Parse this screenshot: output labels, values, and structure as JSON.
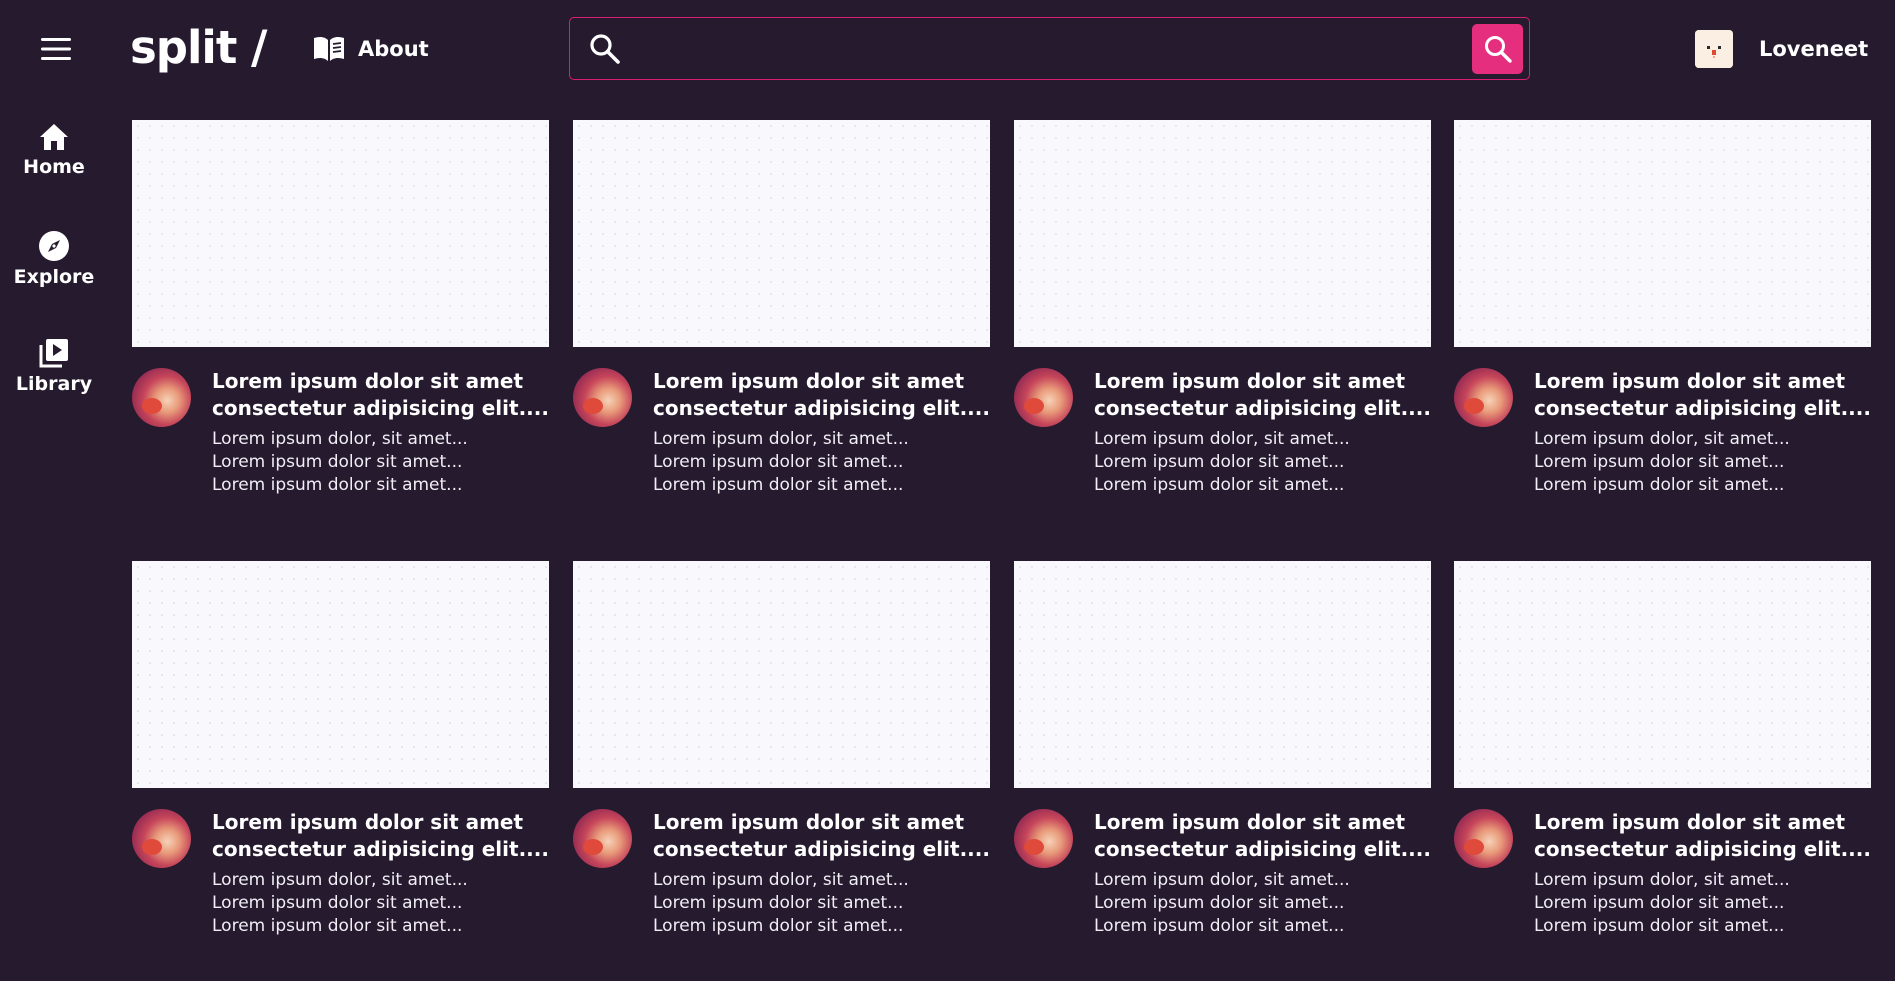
{
  "header": {
    "menu_icon": "hamburger-menu-icon",
    "logo_text": "split /",
    "about_icon": "open-book-icon",
    "about_label": "About",
    "search": {
      "value": "",
      "placeholder": "",
      "lead_icon": "search-icon",
      "submit_icon": "search-icon"
    },
    "user": {
      "avatar_icon": "user-avatar",
      "name": "Loveneet"
    }
  },
  "sidebar": {
    "items": [
      {
        "icon": "home-icon",
        "label": "Home"
      },
      {
        "icon": "compass-icon",
        "label": "Explore"
      },
      {
        "icon": "video-library-icon",
        "label": "Library"
      }
    ]
  },
  "videos": [
    {
      "title_1": "Lorem ipsum dolor sit amet",
      "title_2": "consectetur adipisicing elit....",
      "meta_1": "Lorem ipsum dolor, sit amet...",
      "meta_2": "Lorem ipsum dolor sit amet...",
      "meta_3": "Lorem ipsum dolor sit amet..."
    },
    {
      "title_1": "Lorem ipsum dolor sit amet",
      "title_2": "consectetur adipisicing elit....",
      "meta_1": "Lorem ipsum dolor, sit amet...",
      "meta_2": "Lorem ipsum dolor sit amet...",
      "meta_3": "Lorem ipsum dolor sit amet..."
    },
    {
      "title_1": "Lorem ipsum dolor sit amet",
      "title_2": "consectetur adipisicing elit....",
      "meta_1": "Lorem ipsum dolor, sit amet...",
      "meta_2": "Lorem ipsum dolor sit amet...",
      "meta_3": "Lorem ipsum dolor sit amet..."
    },
    {
      "title_1": "Lorem ipsum dolor sit amet",
      "title_2": "consectetur adipisicing elit....",
      "meta_1": "Lorem ipsum dolor, sit amet...",
      "meta_2": "Lorem ipsum dolor sit amet...",
      "meta_3": "Lorem ipsum dolor sit amet..."
    },
    {
      "title_1": "Lorem ipsum dolor sit amet",
      "title_2": "consectetur adipisicing elit....",
      "meta_1": "Lorem ipsum dolor, sit amet...",
      "meta_2": "Lorem ipsum dolor sit amet...",
      "meta_3": "Lorem ipsum dolor sit amet..."
    },
    {
      "title_1": "Lorem ipsum dolor sit amet",
      "title_2": "consectetur adipisicing elit....",
      "meta_1": "Lorem ipsum dolor, sit amet...",
      "meta_2": "Lorem ipsum dolor sit amet...",
      "meta_3": "Lorem ipsum dolor sit amet..."
    },
    {
      "title_1": "Lorem ipsum dolor sit amet",
      "title_2": "consectetur adipisicing elit....",
      "meta_1": "Lorem ipsum dolor, sit amet...",
      "meta_2": "Lorem ipsum dolor sit amet...",
      "meta_3": "Lorem ipsum dolor sit amet..."
    },
    {
      "title_1": "Lorem ipsum dolor sit amet",
      "title_2": "consectetur adipisicing elit....",
      "meta_1": "Lorem ipsum dolor, sit amet...",
      "meta_2": "Lorem ipsum dolor sit amet...",
      "meta_3": "Lorem ipsum dolor sit amet..."
    }
  ],
  "colors": {
    "background": "#261a2f",
    "accent": "#e62e7f",
    "search_border": "#d81e72",
    "thumbnail": "#f9f8fc",
    "text": "#ffffff"
  }
}
